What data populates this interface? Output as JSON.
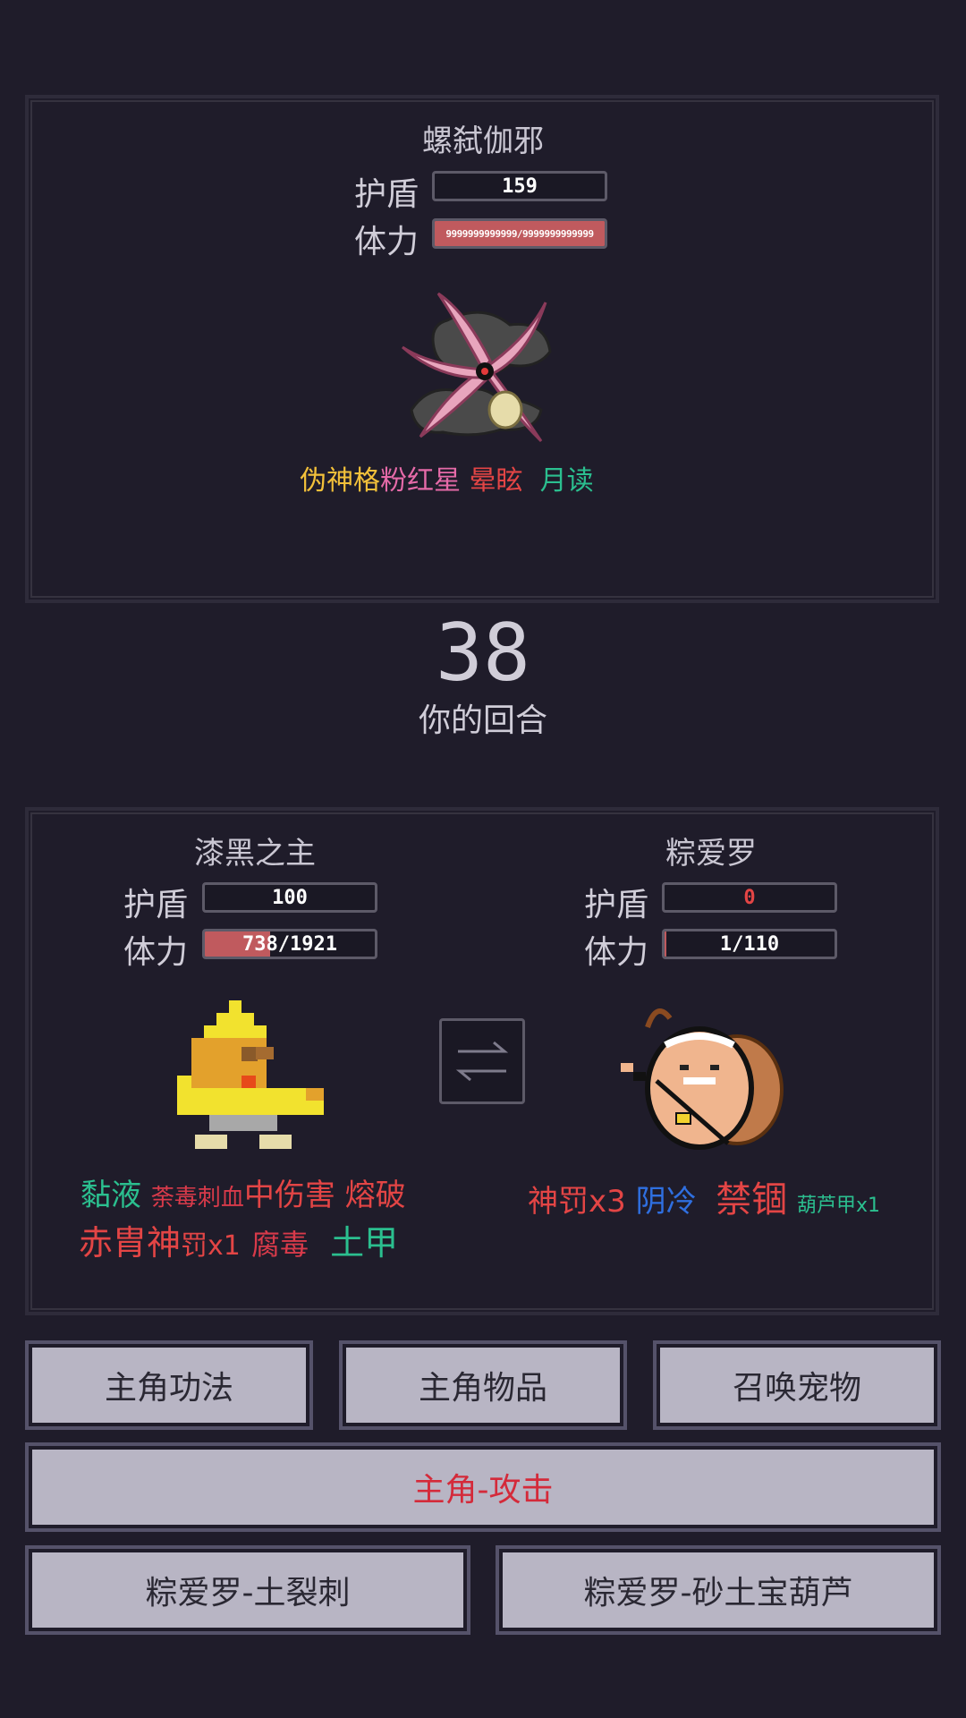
{
  "enemy": {
    "name": "螺弑伽邪",
    "shield_label": "护盾",
    "shield_value": "159",
    "hp_label": "体力",
    "hp_text": "9999999999999/9999999999999",
    "hp_fraction": 1.0,
    "tags": [
      {
        "text": "伪神格",
        "color": "#f2c03a"
      },
      {
        "text": "粉红星",
        "color": "#e56aa8"
      },
      {
        "text": "晕眩",
        "color": "#e34545"
      },
      {
        "text": "月读",
        "color": "#2bbf8f"
      }
    ]
  },
  "turn": {
    "number": "38",
    "label": "你的回合"
  },
  "player": {
    "name": "漆黑之主",
    "shield_label": "护盾",
    "shield_value": "100",
    "hp_label": "体力",
    "hp_text": "738/1921",
    "hp_fraction": 0.384,
    "tags_row1": [
      {
        "text": "黏液",
        "color": "#2bbf8f"
      },
      {
        "text": "荼毒刺血",
        "color": "#d83a4a"
      },
      {
        "text": "中伤害",
        "color": "#e34545"
      },
      {
        "text": "熔破",
        "color": "#e34545"
      }
    ],
    "tags_row2": [
      {
        "text": "赤胄神",
        "color": "#e34545"
      },
      {
        "text": "罚x1",
        "color": "#e34545"
      },
      {
        "text": "腐毒",
        "color": "#d83a4a"
      },
      {
        "text": "土甲",
        "color": "#2bbf8f"
      }
    ]
  },
  "pet": {
    "name": "粽爱罗",
    "shield_label": "护盾",
    "shield_value": "0",
    "hp_label": "体力",
    "hp_text": "1/110",
    "hp_fraction": 0.009,
    "tags": [
      {
        "text": "神罚x3",
        "color": "#e34545"
      },
      {
        "text": "阴冷",
        "color": "#2f6fe0"
      },
      {
        "text": "禁锢",
        "color": "#e34545"
      },
      {
        "text": "葫芦甲x1",
        "color": "#2bbf8f"
      }
    ]
  },
  "swap_icon": "swap-arrows-icon",
  "buttons": {
    "skills": "主角功法",
    "items": "主角物品",
    "summon": "召唤宠物",
    "attack": "主角-攻击",
    "pet_skill1": "粽爱罗-土裂刺",
    "pet_skill2": "粽爱罗-砂土宝葫芦"
  }
}
